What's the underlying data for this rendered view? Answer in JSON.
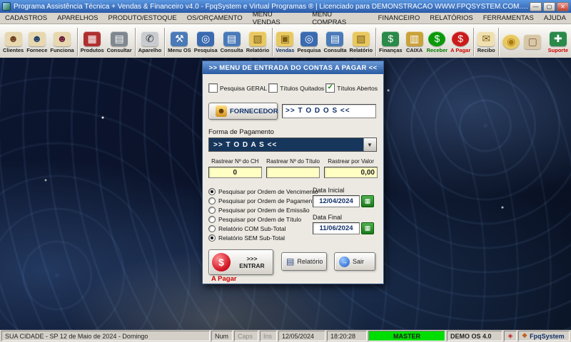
{
  "colors": {
    "receber_green": "#007a00",
    "a_pagar_red": "#cc0000",
    "suporte_red": "#cc0000",
    "master_green": "#00dd00",
    "navy": "#10306a"
  },
  "window": {
    "title": "Programa Assistência Técnica + Vendas & Financeiro v4.0 - FpqSystem e Virtual Programas ® | Licenciado para  DEMONSTRACAO  WWW.FPQSYSTEM.COM.BR",
    "minimize": "—",
    "maximize": "▢",
    "close": "✕"
  },
  "menubar": {
    "items": [
      {
        "name": "cadastros",
        "label": "CADASTROS"
      },
      {
        "name": "aparelhos",
        "label": "APARELHOS"
      },
      {
        "name": "produto-estoque",
        "label": "PRODUTO/ESTOQUE"
      },
      {
        "name": "os-orcamento",
        "label": "OS/ORÇAMENTO"
      },
      {
        "name": "menu-vendas",
        "label": "MENU VENDAS"
      },
      {
        "name": "menu-compras",
        "label": "MENU COMPRAS"
      },
      {
        "name": "financeiro",
        "label": "FINANCEIRO"
      },
      {
        "name": "relatorios",
        "label": "RELATÓRIOS"
      },
      {
        "name": "ferramentas",
        "label": "FERRAMENTAS"
      },
      {
        "name": "ajuda",
        "label": "AJUDA"
      }
    ]
  },
  "toolbar": {
    "buttons": [
      {
        "name": "clientes",
        "label": "Clientes",
        "glyph": "☻",
        "glyph_color": "#6a3a1a",
        "bg": "#e8d8b0"
      },
      {
        "name": "fornece",
        "label": "Fornece",
        "glyph": "☻",
        "glyph_color": "#1a3a6a",
        "bg": "#e8d8b0"
      },
      {
        "name": "funciona",
        "label": "Funciona",
        "glyph": "☻",
        "glyph_color": "#6a1a3a",
        "bg": "#e8d8b0",
        "sep_after": true
      },
      {
        "name": "produtos",
        "label": "Produtos",
        "glyph": "▦",
        "glyph_color": "#ffffff",
        "bg": "#b03030"
      },
      {
        "name": "consultar",
        "label": "Consultar",
        "glyph": "▤",
        "glyph_color": "#ffffff",
        "bg": "#80888f",
        "sep_after": true
      },
      {
        "name": "aparelho",
        "label": "Aparelho",
        "glyph": "✆",
        "glyph_color": "#333333",
        "bg": "#c8ccd0",
        "sep_after": true
      },
      {
        "name": "menu-os",
        "label": "Menu OS",
        "glyph": "⚒",
        "glyph_color": "#ffffff",
        "bg": "#4a7ab8"
      },
      {
        "name": "pesquisa-os",
        "label": "Pesquisa",
        "glyph": "◎",
        "glyph_color": "#ffffff",
        "bg": "#3a6ab0"
      },
      {
        "name": "consulta-os",
        "label": "Consulta",
        "glyph": "▤",
        "glyph_color": "#ffffff",
        "bg": "#4a7ab8"
      },
      {
        "name": "relatorio-os",
        "label": "Relatório",
        "glyph": "▧",
        "glyph_color": "#7a5a10",
        "bg": "#e8c860",
        "sep_after": true
      },
      {
        "name": "vendas",
        "label": "Vendas",
        "glyph": "▣",
        "glyph_color": "#7a5a10",
        "bg": "#e8c860",
        "label_color": "#10306a"
      },
      {
        "name": "pesquisa-vendas",
        "label": "Pesquisa",
        "glyph": "◎",
        "glyph_color": "#ffffff",
        "bg": "#3a6ab0"
      },
      {
        "name": "consulta-vendas",
        "label": "Consulta",
        "glyph": "▤",
        "glyph_color": "#ffffff",
        "bg": "#4a7ab8"
      },
      {
        "name": "relatorio-vendas",
        "label": "Relatório",
        "glyph": "▧",
        "glyph_color": "#7a5a10",
        "bg": "#e8c860",
        "sep_after": true
      },
      {
        "name": "financas",
        "label": "Finanças",
        "glyph": "$",
        "glyph_color": "#ffffff",
        "bg": "#2a8a4a"
      },
      {
        "name": "caixa",
        "label": "CAIXA",
        "glyph": "▥",
        "glyph_color": "#ffffff",
        "bg": "#caa23a"
      },
      {
        "name": "receber",
        "label": "Receber",
        "glyph": "$",
        "glyph_color": "#ffffff",
        "bg": "#0a9a0a",
        "label_color": "#007a00",
        "round": true
      },
      {
        "name": "a-pagar",
        "label": "A Pagar",
        "glyph": "$",
        "glyph_color": "#ffffff",
        "bg": "#cc1a1a",
        "label_color": "#cc0000",
        "round": true,
        "sep_after": true
      },
      {
        "name": "recibo",
        "label": "Recibo",
        "glyph": "✉",
        "glyph_color": "#7a5a10",
        "bg": "#f0e0b0",
        "sep_after": true
      },
      {
        "name": "moeda",
        "label": "",
        "glyph": "◉",
        "glyph_color": "#aa7a10",
        "bg": "#e8c860",
        "round": true
      },
      {
        "name": "pacote",
        "label": "",
        "glyph": "▢",
        "glyph_color": "#7a5a3a",
        "bg": "#d8c8a8"
      },
      {
        "name": "suporte",
        "label": "Suporte",
        "glyph": "✚",
        "glyph_color": "#ffffff",
        "bg": "#2a8a4a",
        "label_color": "#cc0000",
        "push_right": true
      }
    ]
  },
  "dialog": {
    "title": ">>  MENU DE ENTRADA DO CONTAS A PAGAR  <<",
    "check_glyph": "✓",
    "icons": {
      "supplier": "☻",
      "report": "▤",
      "exit": "→",
      "calendar": "▦",
      "dollar": "$",
      "combo_arrow": "▼"
    },
    "checkboxes": [
      {
        "name": "pesquisa-geral",
        "label": "Pesquisa GERAL",
        "checked": false
      },
      {
        "name": "titulos-quitados",
        "label": "Títulos Quitados",
        "checked": false
      },
      {
        "name": "titulos-abertos",
        "label": "Títulos Abertos",
        "checked": true
      }
    ],
    "fornecedor": {
      "button_label": "FORNECEDOR",
      "value": ">> T O D O S <<"
    },
    "forma_pagamento": {
      "label": "Forma de Pagamento",
      "value": ">> T O D A S <<"
    },
    "rastreio": [
      {
        "name": "rastrear-num-ch",
        "label": "Rastrear Nº do CH",
        "value": "0",
        "align": "center"
      },
      {
        "name": "rastrear-num-titulo",
        "label": "Rastrear Nº do Título",
        "value": "",
        "align": "center"
      },
      {
        "name": "rastrear-por-valor",
        "label": "Rastrear por Valor",
        "value": "0,00",
        "align": "right"
      }
    ],
    "radios": [
      {
        "name": "ordem-vencimento",
        "label": "Pesquisar por Ordem de Vencimento",
        "checked": true
      },
      {
        "name": "ordem-pagamento",
        "label": "Pesquisar por Ordem de Pagamento",
        "checked": false
      },
      {
        "name": "ordem-emissao",
        "label": "Pesquisar por Ordem de Emissão",
        "checked": false
      },
      {
        "name": "ordem-titulo",
        "label": "Pesquisar por Ordem de Título",
        "checked": false
      },
      {
        "name": "relatorio-com-subtotal",
        "label": "Relatório COM Sub-Total",
        "checked": false
      },
      {
        "name": "relatorio-sem-subtotal",
        "label": "Relatório SEM Sub-Total",
        "checked": true
      }
    ],
    "dates": [
      {
        "name": "data-inicial",
        "label": "Data Inicial",
        "value": "12/04/2024"
      },
      {
        "name": "data-final",
        "label": "Data Final",
        "value": "11/06/2024"
      }
    ],
    "buttons": {
      "entrar_label": ">>> ENTRAR",
      "entrar_sub": "A Pagar",
      "relatorio": "Relatório",
      "sair": "Sair"
    }
  },
  "statusbar": {
    "cells": [
      {
        "name": "location-date",
        "text": "SUA CIDADE - SP 12 de Maio de 2024 - Domingo",
        "flex": true
      },
      {
        "name": "num-lock",
        "text": "Num",
        "wide": 30
      },
      {
        "name": "caps-lock",
        "text": "Caps",
        "wide": 34,
        "dim": true
      },
      {
        "name": "insert",
        "text": "Ins",
        "wide": 24,
        "dim": true
      },
      {
        "name": "date",
        "text": "12/05/2024",
        "wide": 66
      },
      {
        "name": "time",
        "text": "18:20:28",
        "wide": 56
      },
      {
        "name": "user",
        "text": "MASTER",
        "wide": 108,
        "bg": "#00dd00",
        "bold": true,
        "center": true
      },
      {
        "name": "version",
        "text": "DEMO OS 4.0",
        "wide": 78,
        "bold": true
      },
      {
        "name": "status-icon",
        "text": "◈",
        "wide": 18,
        "color": "#c02020",
        "center": true
      },
      {
        "name": "brand",
        "text": "FpqSystem",
        "wide": 72,
        "bold": true,
        "color": "#10306a",
        "icon": "❖",
        "icon_color": "#c06020"
      }
    ]
  }
}
